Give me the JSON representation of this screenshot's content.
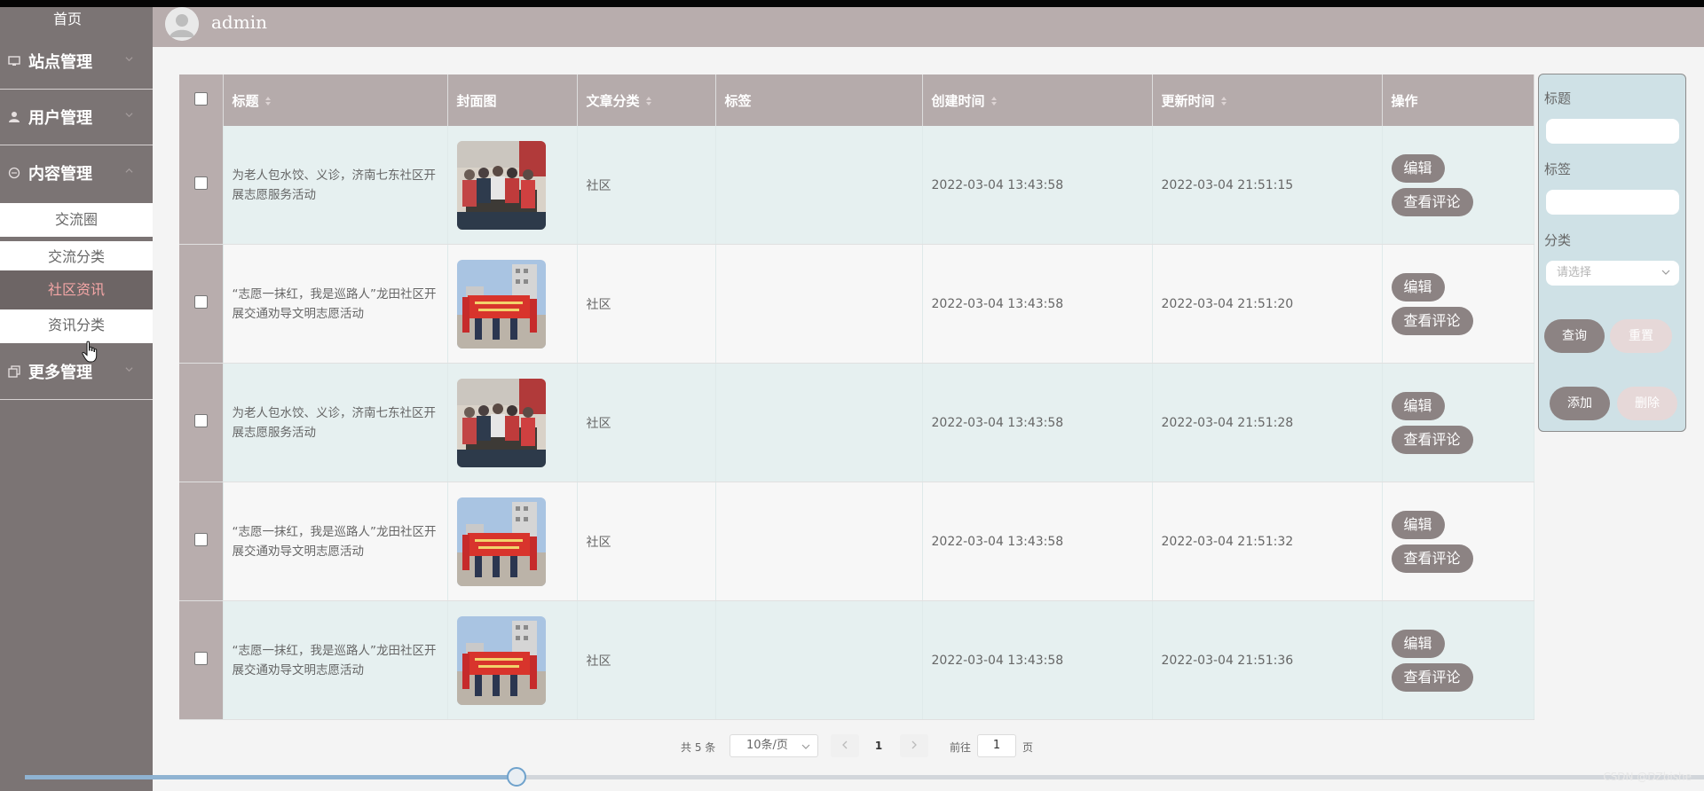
{
  "header": {
    "username": "admin"
  },
  "sidebar": {
    "home": "首页",
    "groups": [
      {
        "label": "站点管理",
        "icon": "monitor-icon"
      },
      {
        "label": "用户管理",
        "icon": "user-icon"
      },
      {
        "label": "内容管理",
        "icon": "chat-icon"
      },
      {
        "label": "更多管理",
        "icon": "copy-icon"
      }
    ],
    "content_items": [
      {
        "label": "交流圈",
        "active": false
      },
      {
        "label": "交流分类",
        "active": false
      },
      {
        "label": "社区资讯",
        "active": true
      },
      {
        "label": "资讯分类",
        "active": false
      }
    ]
  },
  "table": {
    "headers": {
      "title": "标题",
      "cover": "封面图",
      "category": "文章分类",
      "tags": "标签",
      "created": "创建时间",
      "updated": "更新时间",
      "actions": "操作"
    },
    "rows": [
      {
        "title": "为老人包水饺、义诊，济南七东社区开展志愿服务活动",
        "cover": "group-photo-indoor",
        "category": "社区",
        "tags": "",
        "created": "2022-03-04 13:43:58",
        "updated": "2022-03-04 21:51:15"
      },
      {
        "title": "“志愿一抹红，我是巡路人”龙田社区开展交通劝导文明志愿活动",
        "cover": "banner-photo-outdoor",
        "category": "社区",
        "tags": "",
        "created": "2022-03-04 13:43:58",
        "updated": "2022-03-04 21:51:20"
      },
      {
        "title": "为老人包水饺、义诊，济南七东社区开展志愿服务活动",
        "cover": "group-photo-indoor",
        "category": "社区",
        "tags": "",
        "created": "2022-03-04 13:43:58",
        "updated": "2022-03-04 21:51:28"
      },
      {
        "title": "“志愿一抹红，我是巡路人”龙田社区开展交通劝导文明志愿活动",
        "cover": "banner-photo-outdoor",
        "category": "社区",
        "tags": "",
        "created": "2022-03-04 13:43:58",
        "updated": "2022-03-04 21:51:32"
      },
      {
        "title": "“志愿一抹红，我是巡路人”龙田社区开展交通劝导文明志愿活动",
        "cover": "banner-photo-outdoor",
        "category": "社区",
        "tags": "",
        "created": "2022-03-04 13:43:58",
        "updated": "2022-03-04 21:51:36"
      }
    ],
    "edit_label": "编辑",
    "comments_label": "查看评论"
  },
  "search": {
    "title_label": "标题",
    "title_value": "",
    "tag_label": "标签",
    "tag_value": "",
    "category_label": "分类",
    "category_placeholder": "请选择",
    "query_label": "查询",
    "reset_label": "重置",
    "add_label": "添加",
    "delete_label": "删除"
  },
  "pagination": {
    "total_text": "共 5 条",
    "page_size": "10条/页",
    "current_page": "1",
    "goto_label": "前往",
    "goto_value": "1",
    "page_suffix": "页"
  },
  "media": {
    "progress": 0.293
  },
  "watermark": "CSDN @DZbishe"
}
